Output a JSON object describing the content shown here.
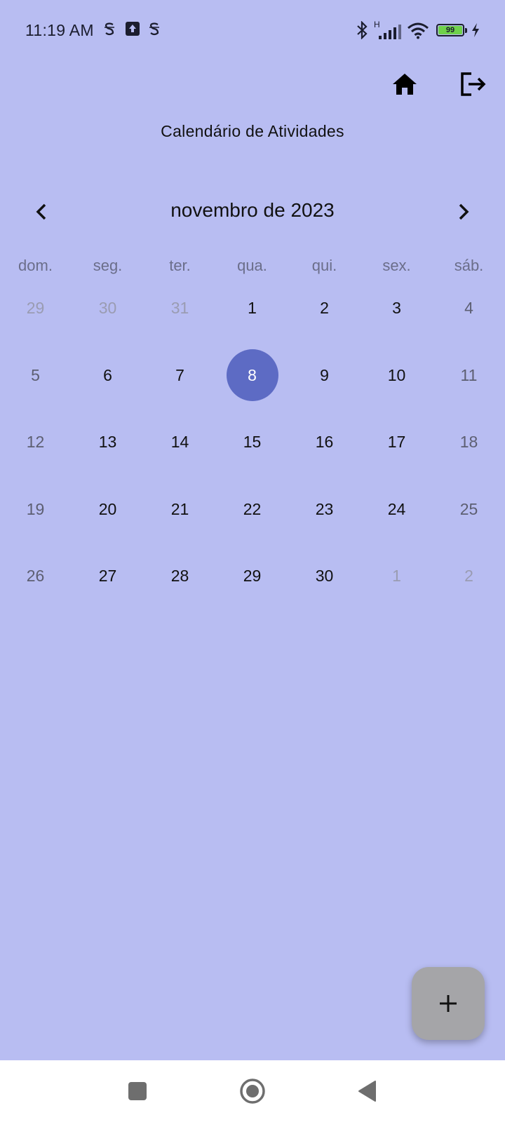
{
  "status_bar": {
    "time": "11:19 AM",
    "battery_level": "99",
    "network_type": "H",
    "icons": [
      "signal-app-icon",
      "upload-icon",
      "signal-app-icon",
      "bluetooth-icon",
      "cell-signal-icon",
      "wifi-icon",
      "battery-icon",
      "charging-bolt-icon"
    ]
  },
  "app_bar": {
    "actions": [
      "home-icon",
      "logout-icon"
    ]
  },
  "page": {
    "title": "Calendário de Atividades"
  },
  "calendar": {
    "month_label": "novembro de 2023",
    "prev_icon": "chevron-left-icon",
    "next_icon": "chevron-right-icon",
    "weekdays": [
      "dom.",
      "seg.",
      "ter.",
      "qua.",
      "qui.",
      "sex.",
      "sáb."
    ],
    "selected_day": "8",
    "days": [
      {
        "label": "29",
        "outside": true
      },
      {
        "label": "30",
        "outside": true
      },
      {
        "label": "31",
        "outside": true
      },
      {
        "label": "1"
      },
      {
        "label": "2"
      },
      {
        "label": "3"
      },
      {
        "label": "4"
      },
      {
        "label": "5"
      },
      {
        "label": "6"
      },
      {
        "label": "7"
      },
      {
        "label": "8",
        "selected": true
      },
      {
        "label": "9"
      },
      {
        "label": "10"
      },
      {
        "label": "11"
      },
      {
        "label": "12"
      },
      {
        "label": "13"
      },
      {
        "label": "14"
      },
      {
        "label": "15"
      },
      {
        "label": "16"
      },
      {
        "label": "17"
      },
      {
        "label": "18"
      },
      {
        "label": "19"
      },
      {
        "label": "20"
      },
      {
        "label": "21"
      },
      {
        "label": "22"
      },
      {
        "label": "23"
      },
      {
        "label": "24"
      },
      {
        "label": "25"
      },
      {
        "label": "26"
      },
      {
        "label": "27"
      },
      {
        "label": "28"
      },
      {
        "label": "29"
      },
      {
        "label": "30"
      },
      {
        "label": "1",
        "outside": true
      },
      {
        "label": "2",
        "outside": true
      }
    ]
  },
  "fab": {
    "icon": "plus-icon"
  },
  "system_nav": {
    "buttons": [
      "recents-square-icon",
      "home-circle-icon",
      "back-triangle-icon"
    ]
  },
  "colors": {
    "background": "#b8bdf2",
    "selected_day": "#5d6bc4",
    "fab": "#a5a5a8",
    "battery_fill": "#6fd14b"
  }
}
